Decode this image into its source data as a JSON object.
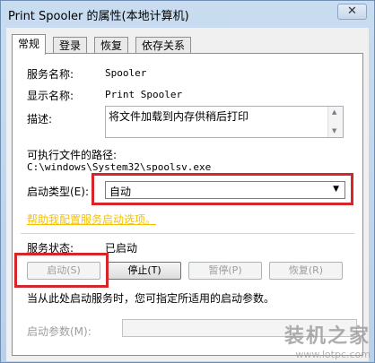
{
  "window": {
    "title": "Print Spooler 的属性(本地计算机)",
    "close_label": "✕"
  },
  "tabs": [
    {
      "label": "常规",
      "active": true
    },
    {
      "label": "登录",
      "active": false
    },
    {
      "label": "恢复",
      "active": false
    },
    {
      "label": "依存关系",
      "active": false
    }
  ],
  "general": {
    "service_name_label": "服务名称:",
    "service_name_value": "Spooler",
    "display_name_label": "显示名称:",
    "display_name_value": "Print Spooler",
    "description_label": "描述:",
    "description_value": "将文件加载到内存供稍后打印",
    "exe_path_label": "可执行文件的路径:",
    "exe_path_value": "C:\\windows\\System32\\spoolsv.exe",
    "startup_type_label": "启动类型(E):",
    "startup_type_value": "自动",
    "help_link": "帮助我配置服务启动选项。",
    "status_label": "服务状态:",
    "status_value": "已启动",
    "buttons": {
      "start": "启动(S)",
      "stop": "停止(T)",
      "pause": "暂停(P)",
      "resume": "恢复(R)"
    },
    "start_hint": "当从此处启动服务时，您可指定所适用的启动参数。",
    "start_params_label": "启动参数(M):",
    "start_params_value": ""
  },
  "watermark": {
    "logo_text": "装机之家",
    "url": "www.lotpc.com"
  },
  "colors": {
    "highlight": "#d5262c",
    "link": "#f5c200"
  }
}
